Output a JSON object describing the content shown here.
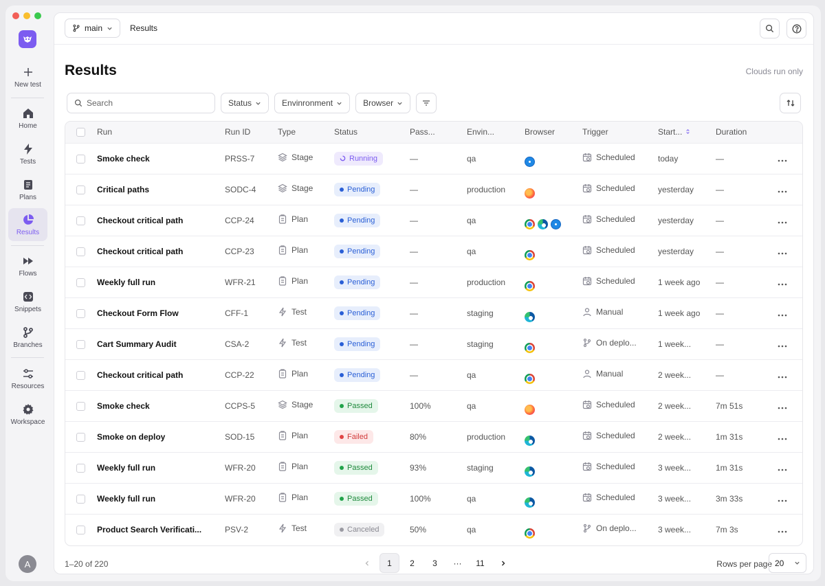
{
  "sidebar": {
    "items": [
      {
        "label": "New test",
        "icon": "plus-icon"
      },
      {
        "label": "Home",
        "icon": "home-icon"
      },
      {
        "label": "Tests",
        "icon": "bolt-icon"
      },
      {
        "label": "Plans",
        "icon": "document-icon"
      },
      {
        "label": "Results",
        "icon": "pie-chart-icon"
      },
      {
        "label": "Flows",
        "icon": "fast-forward-icon"
      },
      {
        "label": "Snippets",
        "icon": "code-icon"
      },
      {
        "label": "Branches",
        "icon": "branch-icon"
      },
      {
        "label": "Resources",
        "icon": "sliders-icon"
      },
      {
        "label": "Workspace",
        "icon": "gear-icon"
      }
    ],
    "avatar": "A"
  },
  "topbar": {
    "branch": "main",
    "title": "Results"
  },
  "page": {
    "title": "Results",
    "clouds_note": "Clouds run only"
  },
  "filters": {
    "search_placeholder": "Search",
    "status": "Status",
    "environment": "Envinronment",
    "browser": "Browser"
  },
  "table": {
    "headers": [
      "Run",
      "Run ID",
      "Type",
      "Status",
      "Pass...",
      "Envin...",
      "Browser",
      "Trigger",
      "Start...",
      "Duration"
    ],
    "rows": [
      {
        "run": "Smoke check",
        "run_id": "PRSS-7",
        "type": "Stage",
        "status": "Running",
        "pass": "—",
        "env": "qa",
        "browsers": [
          "safari"
        ],
        "trigger": "Scheduled",
        "start": "today",
        "duration": "—"
      },
      {
        "run": "Critical paths",
        "run_id": "SODC-4",
        "type": "Stage",
        "status": "Pending",
        "pass": "—",
        "env": "production",
        "browsers": [
          "firefox"
        ],
        "trigger": "Scheduled",
        "start": "yesterday",
        "duration": "—"
      },
      {
        "run": "Checkout critical path",
        "run_id": "CCP-24",
        "type": "Plan",
        "status": "Pending",
        "pass": "—",
        "env": "qa",
        "browsers": [
          "chrome",
          "edge",
          "safari"
        ],
        "trigger": "Scheduled",
        "start": "yesterday",
        "duration": "—"
      },
      {
        "run": "Checkout critical path",
        "run_id": "CCP-23",
        "type": "Plan",
        "status": "Pending",
        "pass": "—",
        "env": "qa",
        "browsers": [
          "chrome"
        ],
        "trigger": "Scheduled",
        "start": "yesterday",
        "duration": "—"
      },
      {
        "run": "Weekly full run",
        "run_id": "WFR-21",
        "type": "Plan",
        "status": "Pending",
        "pass": "—",
        "env": "production",
        "browsers": [
          "chrome"
        ],
        "trigger": "Scheduled",
        "start": "1 week ago",
        "duration": "—"
      },
      {
        "run": "Checkout Form Flow",
        "run_id": "CFF-1",
        "type": "Test",
        "status": "Pending",
        "pass": "—",
        "env": "staging",
        "browsers": [
          "edge"
        ],
        "trigger": "Manual",
        "start": "1 week ago",
        "duration": "—"
      },
      {
        "run": "Cart Summary Audit",
        "run_id": "CSA-2",
        "type": "Test",
        "status": "Pending",
        "pass": "—",
        "env": "staging",
        "browsers": [
          "chrome"
        ],
        "trigger": "On deplo...",
        "start": "1 week...",
        "duration": "—"
      },
      {
        "run": "Checkout critical path",
        "run_id": "CCP-22",
        "type": "Plan",
        "status": "Pending",
        "pass": "—",
        "env": "qa",
        "browsers": [
          "chrome"
        ],
        "trigger": "Manual",
        "start": "2 week...",
        "duration": "—"
      },
      {
        "run": "Smoke check",
        "run_id": "CCPS-5",
        "type": "Stage",
        "status": "Passed",
        "pass": "100%",
        "env": "qa",
        "browsers": [
          "firefox"
        ],
        "trigger": "Scheduled",
        "start": "2 week...",
        "duration": "7m 51s"
      },
      {
        "run": "Smoke on deploy",
        "run_id": "SOD-15",
        "type": "Plan",
        "status": "Failed",
        "pass": "80%",
        "env": "production",
        "browsers": [
          "edge"
        ],
        "trigger": "Scheduled",
        "start": "2 week...",
        "duration": "1m 31s"
      },
      {
        "run": "Weekly full run",
        "run_id": "WFR-20",
        "type": "Plan",
        "status": "Passed",
        "pass": "93%",
        "env": "staging",
        "browsers": [
          "edge"
        ],
        "trigger": "Scheduled",
        "start": "3 week...",
        "duration": "1m 31s"
      },
      {
        "run": "Weekly full run",
        "run_id": "WFR-20",
        "type": "Plan",
        "status": "Passed",
        "pass": "100%",
        "env": "qa",
        "browsers": [
          "edge"
        ],
        "trigger": "Scheduled",
        "start": "3 week...",
        "duration": "3m 33s"
      },
      {
        "run": "Product Search Verificati...",
        "run_id": "PSV-2",
        "type": "Test",
        "status": "Canceled",
        "pass": "50%",
        "env": "qa",
        "browsers": [
          "chrome"
        ],
        "trigger": "On deplo...",
        "start": "3 week...",
        "duration": "7m 3s"
      }
    ]
  },
  "footer": {
    "count": "1–20 of 220",
    "pages": [
      "1",
      "2",
      "3",
      "···",
      "11"
    ],
    "rows_per_page_label": "Rows per page",
    "rows_per_page": "20"
  }
}
